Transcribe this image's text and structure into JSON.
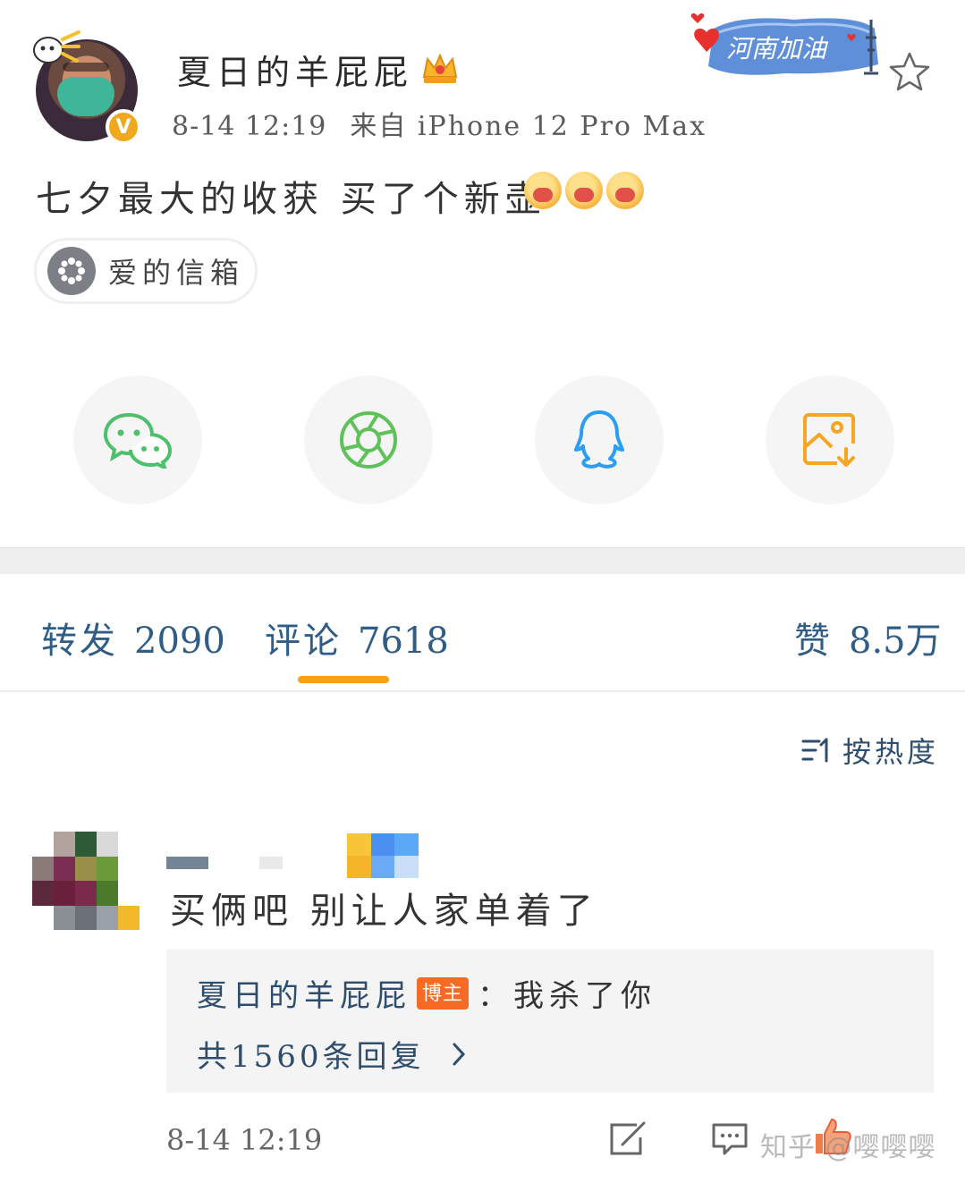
{
  "user": {
    "name": "夏日的羊屁屁",
    "verified_mark": "V",
    "time": "8-14 12:19",
    "source": "来自 iPhone 12 Pro Max"
  },
  "header_badge": {
    "text": "河南加油"
  },
  "post": {
    "text": "七夕最大的收获 买了个新壶",
    "emoji_names": [
      "heart-hug-emoji",
      "heart-hug-emoji",
      "heart-hug-emoji"
    ]
  },
  "topic_chip": {
    "label": "爱的信箱",
    "icon": "flower-icon"
  },
  "share": {
    "items": [
      {
        "name": "wechat-icon",
        "color": "#4cc06b"
      },
      {
        "name": "moments-aperture-icon",
        "color": "#5fc15a"
      },
      {
        "name": "qq-penguin-icon",
        "color": "#2a9df4"
      },
      {
        "name": "save-image-icon",
        "color": "#f5a623"
      }
    ]
  },
  "tabs": {
    "repost": {
      "label": "转发",
      "count": "2090"
    },
    "comments": {
      "label": "评论",
      "count": "7618"
    },
    "likes": {
      "label": "赞",
      "count": "8.5万"
    },
    "active_color": "#f6a21b"
  },
  "sort": {
    "label": "按热度"
  },
  "comment": {
    "text": "买俩吧 别让人家单着了",
    "reply": {
      "author": "夏日的羊屁屁",
      "tag": "博主",
      "content": "：我杀了你",
      "count_text": "共1560条回复"
    },
    "time": "8-14 12:19"
  },
  "watermark": "知乎 @嘤嘤嘤"
}
